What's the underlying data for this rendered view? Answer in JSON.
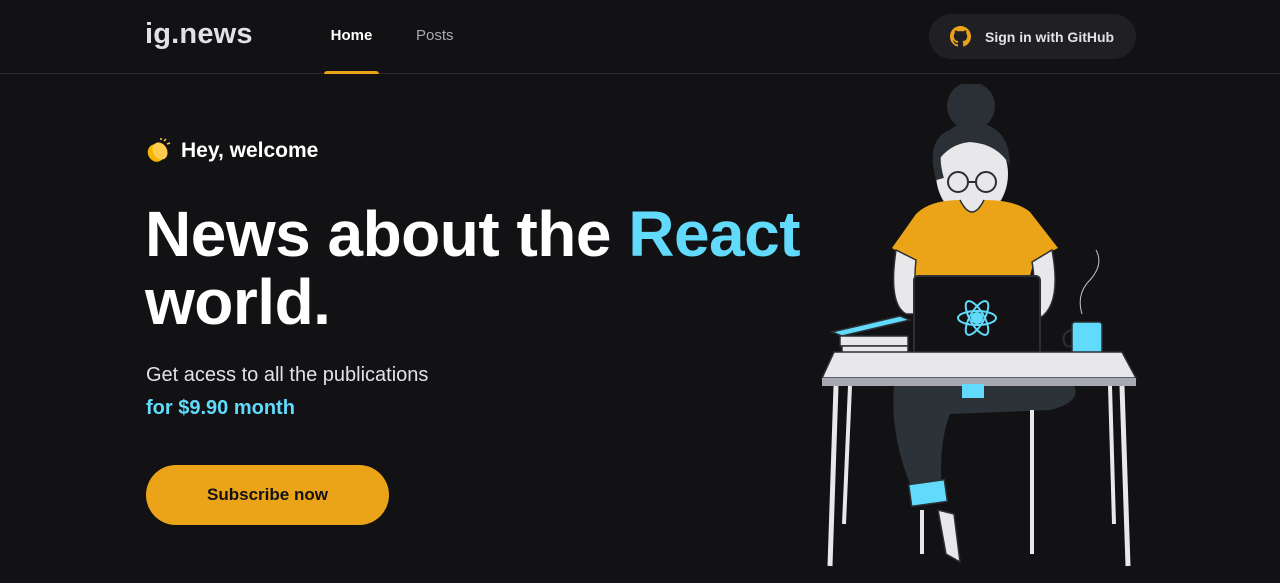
{
  "header": {
    "logo": "ig.news",
    "nav": [
      {
        "label": "Home",
        "active": true
      },
      {
        "label": "Posts",
        "active": false
      }
    ],
    "signin_label": "Sign in with GitHub",
    "signin_icon": "github-icon"
  },
  "hero": {
    "welcome_icon": "clapping-hands-icon",
    "welcome": "Hey, welcome",
    "headline_part1": "News about the ",
    "headline_accent": "React",
    "headline_part2": "world.",
    "subtitle": "Get acess to all the publications",
    "price": "for $9.90 month",
    "cta": "Subscribe now"
  },
  "colors": {
    "background": "#121214",
    "accent_yellow": "#eba417",
    "accent_cyan": "#61dafb",
    "surface": "#202024"
  }
}
